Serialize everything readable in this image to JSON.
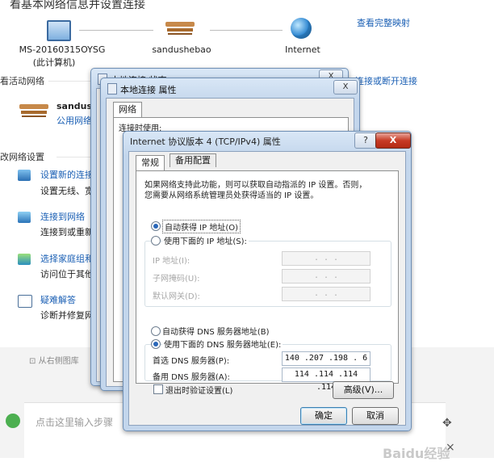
{
  "nsc": {
    "top_title": "看基本网络信息并设置连接",
    "view_full_map": "查看完整映射",
    "computer_name": "MS-20160315OYSG",
    "computer_sub": "(此计算机)",
    "network_name": "sandushebao",
    "internet": "Internet",
    "active_networks": "看活动网络",
    "connect_disconnect": "连接或断开连接",
    "network_item_name": "sandush",
    "network_item_type": "公用网络",
    "change_settings": "改网络设置",
    "tasks": [
      {
        "title": "设置新的连接",
        "desc": "设置无线、宽"
      },
      {
        "title": "连接到网络",
        "desc": "连接到或重新"
      },
      {
        "title": "选择家庭组和",
        "desc": "访问位于其他"
      },
      {
        "title": "疑难解答",
        "desc": "诊断并修复网"
      }
    ]
  },
  "status_window": {
    "title": "本地连接 状态",
    "close": "X"
  },
  "props_window": {
    "title": "本地连接 属性",
    "close": "X",
    "tab": "网络",
    "label_partial": "连接时使用:"
  },
  "ipv4_dialog": {
    "title": "Internet 协议版本 4 (TCP/IPv4) 属性",
    "help": "?",
    "close": "X",
    "tabs": [
      "常规",
      "备用配置"
    ],
    "description_line1": "如果网络支持此功能，则可以获取自动指派的 IP 设置。否则，",
    "description_line2": "您需要从网络系统管理员处获得适当的 IP 设置。",
    "auto_ip": "自动获得 IP 地址(O)",
    "manual_ip": "使用下面的 IP 地址(S):",
    "ip_address": "IP 地址(I):",
    "subnet_mask": "子网掩码(U):",
    "default_gateway": "默认网关(D):",
    "auto_dns": "自动获得 DNS 服务器地址(B)",
    "manual_dns": "使用下面的 DNS 服务器地址(E):",
    "preferred_dns_label": "首选 DNS 服务器(P):",
    "preferred_dns_value": "140 .207 .198 . 6",
    "alternate_dns_label": "备用 DNS 服务器(A):",
    "alternate_dns_value": "114 .114 .114 .114",
    "validate_on_exit": "退出时验证设置(L)",
    "advanced": "高级(V)...",
    "ok": "确定",
    "cancel": "取消",
    "empty_ip": ". . ."
  },
  "page_bottom": {
    "from_gallery": "从右侧图库",
    "input_placeholder": "点击这里输入步骤",
    "watermark": "Baidu经验",
    "move_glyph": "✥",
    "close_glyph": "×"
  }
}
